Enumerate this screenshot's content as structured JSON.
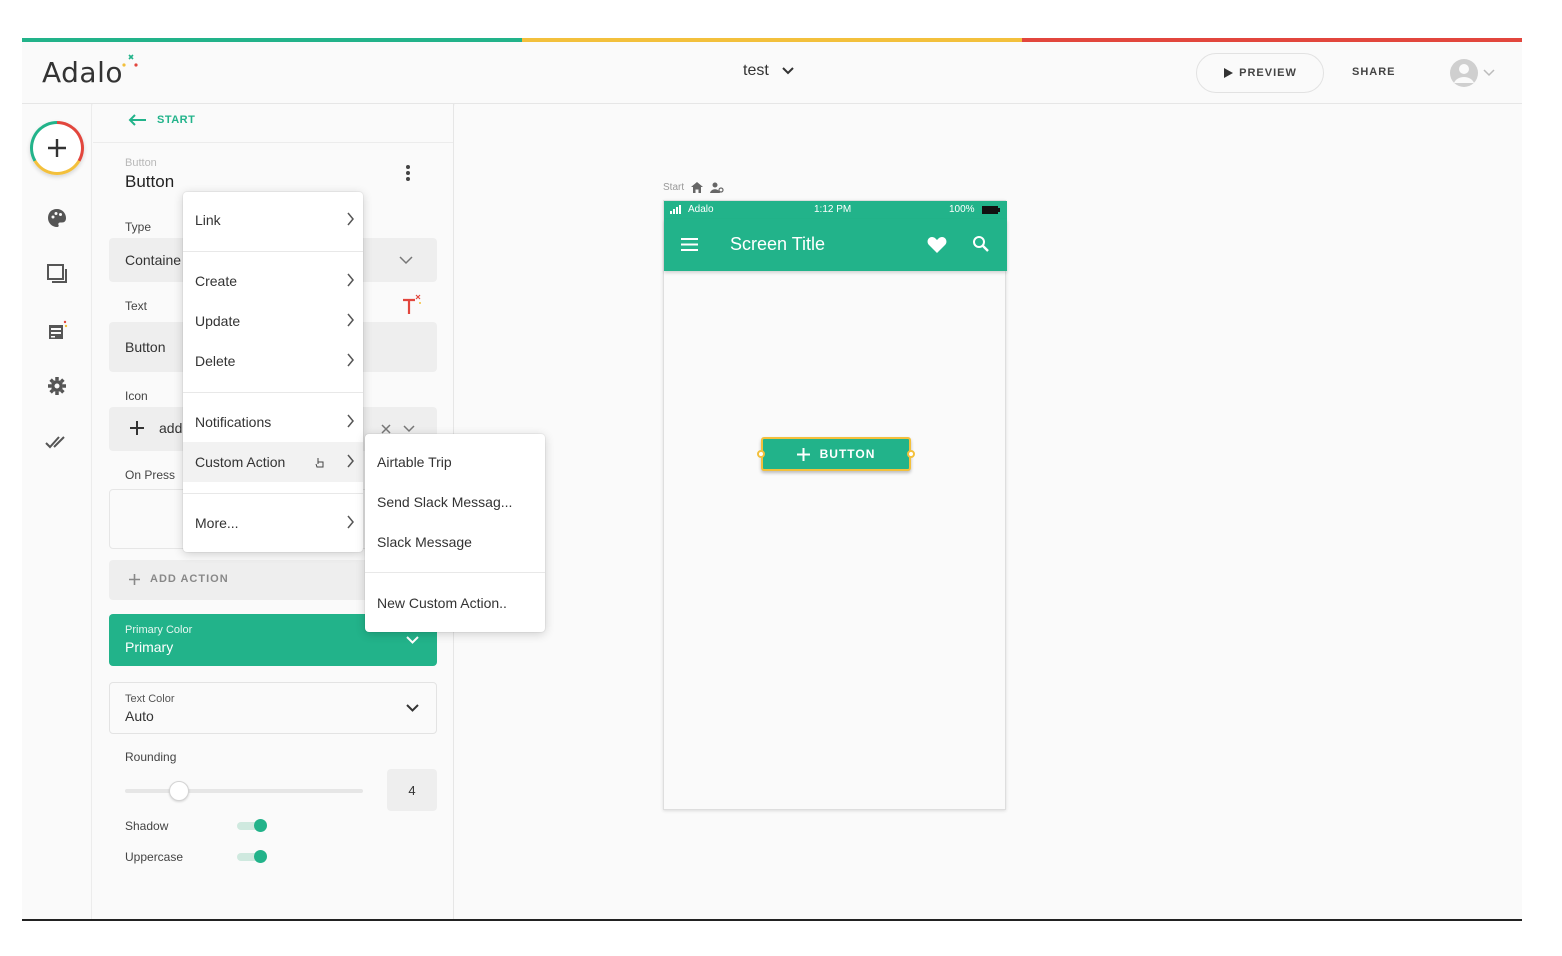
{
  "colors": {
    "accent": "#22b38a",
    "stripe": [
      "#22b38a",
      "#f3c03c",
      "#e2463d"
    ],
    "selection": "#f3c03c"
  },
  "header": {
    "logo": "Adalo",
    "app_name": "test",
    "preview_label": "PREVIEW",
    "share_label": "SHARE"
  },
  "rail": {
    "icons": [
      "add-icon",
      "palette-icon",
      "screens-icon",
      "database-icon",
      "settings-icon",
      "publish-check-icon"
    ]
  },
  "panel": {
    "back_label": "START",
    "component_kind": "Button",
    "component_name": "Button",
    "type": {
      "label": "Type",
      "value": "Containe"
    },
    "text": {
      "label": "Text",
      "value": "Button"
    },
    "icon": {
      "label": "Icon",
      "value": "add"
    },
    "on_press": {
      "label": "On Press"
    },
    "add_action_label": "ADD ACTION",
    "primary_color": {
      "label": "Primary Color",
      "value": "Primary"
    },
    "text_color": {
      "label": "Text Color",
      "value": "Auto"
    },
    "rounding": {
      "label": "Rounding",
      "value": "4"
    },
    "shadow": {
      "label": "Shadow",
      "on": true
    },
    "uppercase": {
      "label": "Uppercase",
      "on": true
    }
  },
  "action_menu": {
    "items": [
      "Link",
      "Create",
      "Update",
      "Delete",
      "Notifications",
      "Custom Action",
      "More..."
    ],
    "highlighted": "Custom Action"
  },
  "custom_action_menu": {
    "items": [
      "Airtable Trip",
      "Send Slack Messag...",
      "Slack Message"
    ],
    "new_label": "New Custom Action.."
  },
  "canvas": {
    "screen_label": "Start",
    "status_carrier": "Adalo",
    "status_time": "1:12 PM",
    "status_battery": "100%",
    "screen_title": "Screen Title",
    "button_label": "BUTTON"
  }
}
